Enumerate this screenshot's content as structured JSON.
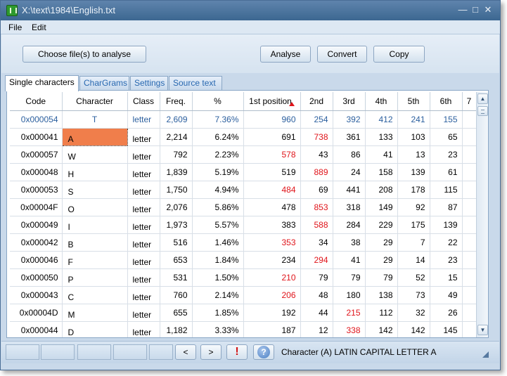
{
  "window": {
    "title": "X:\\text\\1984\\English.txt"
  },
  "menu": {
    "file": "File",
    "edit": "Edit"
  },
  "toolbar": {
    "choose_label": "Choose file(s) to analyse",
    "analyse_label": "Analyse",
    "convert_label": "Convert",
    "copy_label": "Copy"
  },
  "tabs": [
    "Single characters",
    "CharGrams",
    "Settings",
    "Source text"
  ],
  "active_tab": "Single characters",
  "table": {
    "headers": [
      "Code",
      "Character",
      "Class",
      "Freq.",
      "%",
      "1st position",
      "2nd",
      "3rd",
      "4th",
      "5th",
      "6th",
      "7"
    ],
    "sort_column": "1st position",
    "rows": [
      {
        "code": "0x000054",
        "char": "T",
        "cls": "letter",
        "freq": "2,609",
        "pct": "7.36%",
        "p": [
          "960",
          "254",
          "392",
          "412",
          "241",
          "155"
        ],
        "hi": 0
      },
      {
        "code": "0x000041",
        "char": "A",
        "cls": "letter",
        "freq": "2,214",
        "pct": "6.24%",
        "p": [
          "691",
          "738",
          "361",
          "133",
          "103",
          "65"
        ],
        "hi": 1
      },
      {
        "code": "0x000057",
        "char": "W",
        "cls": "letter",
        "freq": "792",
        "pct": "2.23%",
        "p": [
          "578",
          "43",
          "86",
          "41",
          "13",
          "23"
        ],
        "hi": 0
      },
      {
        "code": "0x000048",
        "char": "H",
        "cls": "letter",
        "freq": "1,839",
        "pct": "5.19%",
        "p": [
          "519",
          "889",
          "24",
          "158",
          "139",
          "61"
        ],
        "hi": 1
      },
      {
        "code": "0x000053",
        "char": "S",
        "cls": "letter",
        "freq": "1,750",
        "pct": "4.94%",
        "p": [
          "484",
          "69",
          "441",
          "208",
          "178",
          "115"
        ],
        "hi": 0
      },
      {
        "code": "0x00004F",
        "char": "O",
        "cls": "letter",
        "freq": "2,076",
        "pct": "5.86%",
        "p": [
          "478",
          "853",
          "318",
          "149",
          "92",
          "87"
        ],
        "hi": 1
      },
      {
        "code": "0x000049",
        "char": "I",
        "cls": "letter",
        "freq": "1,973",
        "pct": "5.57%",
        "p": [
          "383",
          "588",
          "284",
          "229",
          "175",
          "139"
        ],
        "hi": 1
      },
      {
        "code": "0x000042",
        "char": "B",
        "cls": "letter",
        "freq": "516",
        "pct": "1.46%",
        "p": [
          "353",
          "34",
          "38",
          "29",
          "7",
          "22"
        ],
        "hi": 0
      },
      {
        "code": "0x000046",
        "char": "F",
        "cls": "letter",
        "freq": "653",
        "pct": "1.84%",
        "p": [
          "234",
          "294",
          "41",
          "29",
          "14",
          "23"
        ],
        "hi": 1
      },
      {
        "code": "0x000050",
        "char": "P",
        "cls": "letter",
        "freq": "531",
        "pct": "1.50%",
        "p": [
          "210",
          "79",
          "79",
          "79",
          "52",
          "15"
        ],
        "hi": 0
      },
      {
        "code": "0x000043",
        "char": "C",
        "cls": "letter",
        "freq": "760",
        "pct": "2.14%",
        "p": [
          "206",
          "48",
          "180",
          "138",
          "73",
          "49"
        ],
        "hi": 0
      },
      {
        "code": "0x00004D",
        "char": "M",
        "cls": "letter",
        "freq": "655",
        "pct": "1.85%",
        "p": [
          "192",
          "44",
          "215",
          "112",
          "32",
          "26"
        ],
        "hi": 2
      },
      {
        "code": "0x000044",
        "char": "D",
        "cls": "letter",
        "freq": "1,182",
        "pct": "3.33%",
        "p": [
          "187",
          "12",
          "338",
          "142",
          "142",
          "145"
        ],
        "hi": 2
      }
    ]
  },
  "selected_row": 1,
  "statusbar": {
    "prev_label": "<",
    "next_label": ">",
    "alert_label": "!",
    "help_label": "?",
    "status_text": "Character (A) LATIN CAPITAL LETTER A"
  },
  "colors": {
    "highlight": "#e0141a",
    "selection": "#f07e4b",
    "accent": "#2b5f9e"
  }
}
